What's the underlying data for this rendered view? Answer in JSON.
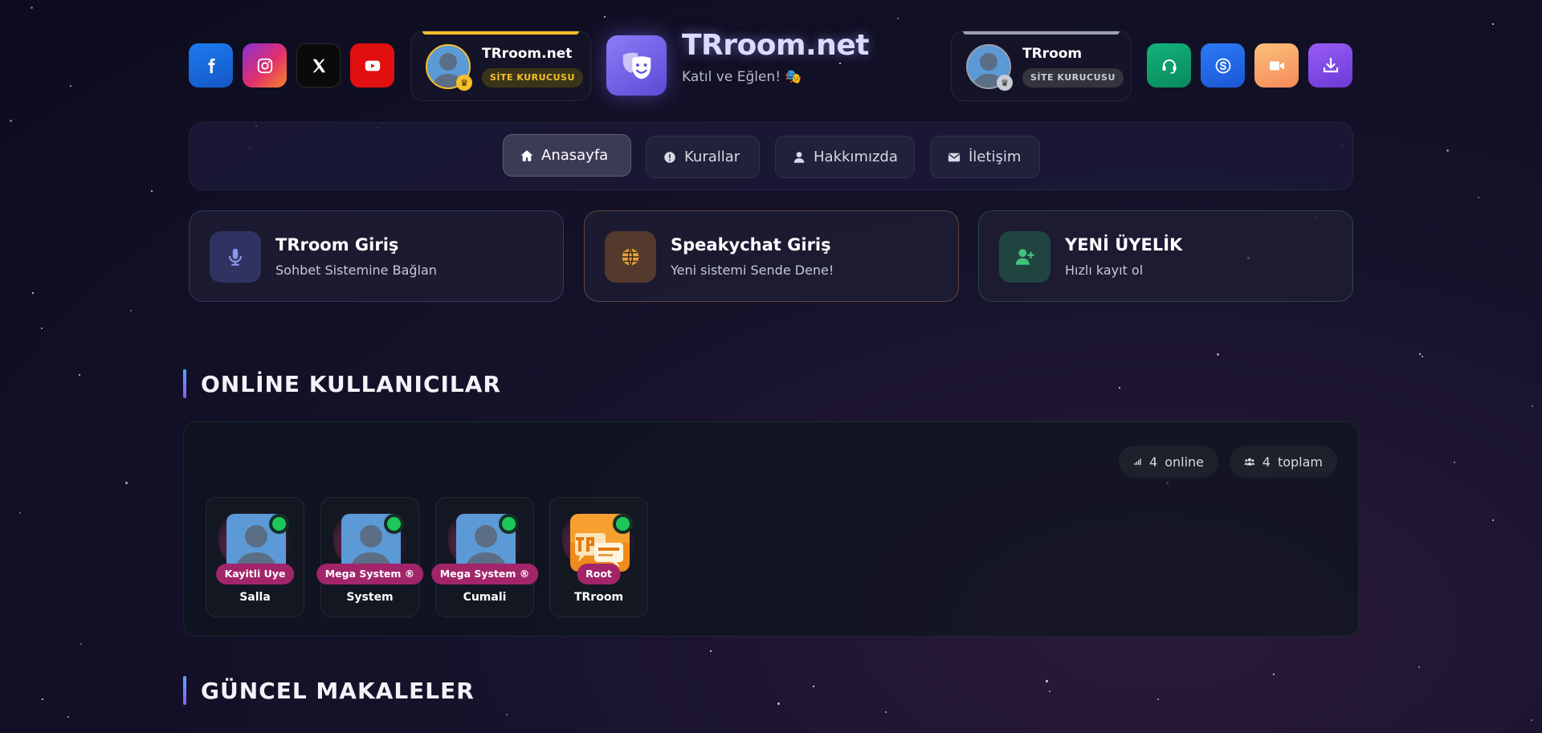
{
  "header": {
    "socials": [
      {
        "name": "facebook",
        "icon": "facebook-icon",
        "color": "#1d7bf0"
      },
      {
        "name": "instagram",
        "icon": "instagram-icon",
        "color": "#e1306c"
      },
      {
        "name": "x",
        "icon": "x-icon",
        "color": "#0a0a0a"
      },
      {
        "name": "youtube",
        "icon": "youtube-icon",
        "color": "#e11010"
      }
    ],
    "founder_left": {
      "name": "TRroom.net",
      "badge": "SİTE KURUCUSU",
      "accent": "#f5c02b"
    },
    "founder_right": {
      "name": "TRroom",
      "badge": "SİTE KURUCUSU",
      "accent": "#9aa0ad"
    },
    "brand": {
      "title": "TRroom.net",
      "subtitle": "Katıl ve Eğlen! 🎭",
      "icon": "theater-masks-icon"
    },
    "utilities": [
      {
        "name": "support",
        "icon": "headset-icon",
        "color": "#12b27a"
      },
      {
        "name": "skype",
        "icon": "skype-icon",
        "color": "#2b7bf5"
      },
      {
        "name": "video",
        "icon": "video-camera-icon",
        "color": "#f59a6a"
      },
      {
        "name": "download",
        "icon": "download-icon",
        "color": "#8a4cf0"
      }
    ]
  },
  "nav": {
    "items": [
      {
        "label": "Anasayfa",
        "icon": "home-icon",
        "active": true
      },
      {
        "label": "Kurallar",
        "icon": "exclamation-circle-icon",
        "active": false
      },
      {
        "label": "Hakkımızda",
        "icon": "user-icon",
        "active": false
      },
      {
        "label": "İletişim",
        "icon": "envelope-icon",
        "active": false
      }
    ]
  },
  "cards": [
    {
      "title": "TRroom Giriş",
      "desc": "Sohbet Sistemine Bağlan",
      "icon": "microphone-icon",
      "accent": "#8a95e8"
    },
    {
      "title": "Speakychat Giriş",
      "desc": "Yeni sistemi Sende Dene!",
      "icon": "globe-icon",
      "accent": "#e8a03a"
    },
    {
      "title": "YENİ ÜYELİK",
      "desc": "Hızlı kayıt ol",
      "icon": "user-plus-icon",
      "accent": "#3ec47a"
    }
  ],
  "online": {
    "title": "ONLİNE KULLANICILAR",
    "online_count": "4",
    "online_label": "online",
    "total_count": "4",
    "total_label": "toplam",
    "users": [
      {
        "name": "Salla",
        "role": "Kayitli Uye"
      },
      {
        "name": "System",
        "role": "Mega System ®"
      },
      {
        "name": "Cumali",
        "role": "Mega System ®"
      },
      {
        "name": "TRroom",
        "role": "Root"
      }
    ]
  },
  "articles": {
    "title": "GÜNCEL MAKALELER"
  },
  "colors": {
    "accent": "#8b7cf6",
    "online_dot": "#1ec75a",
    "role_badge": "#a2256a"
  }
}
